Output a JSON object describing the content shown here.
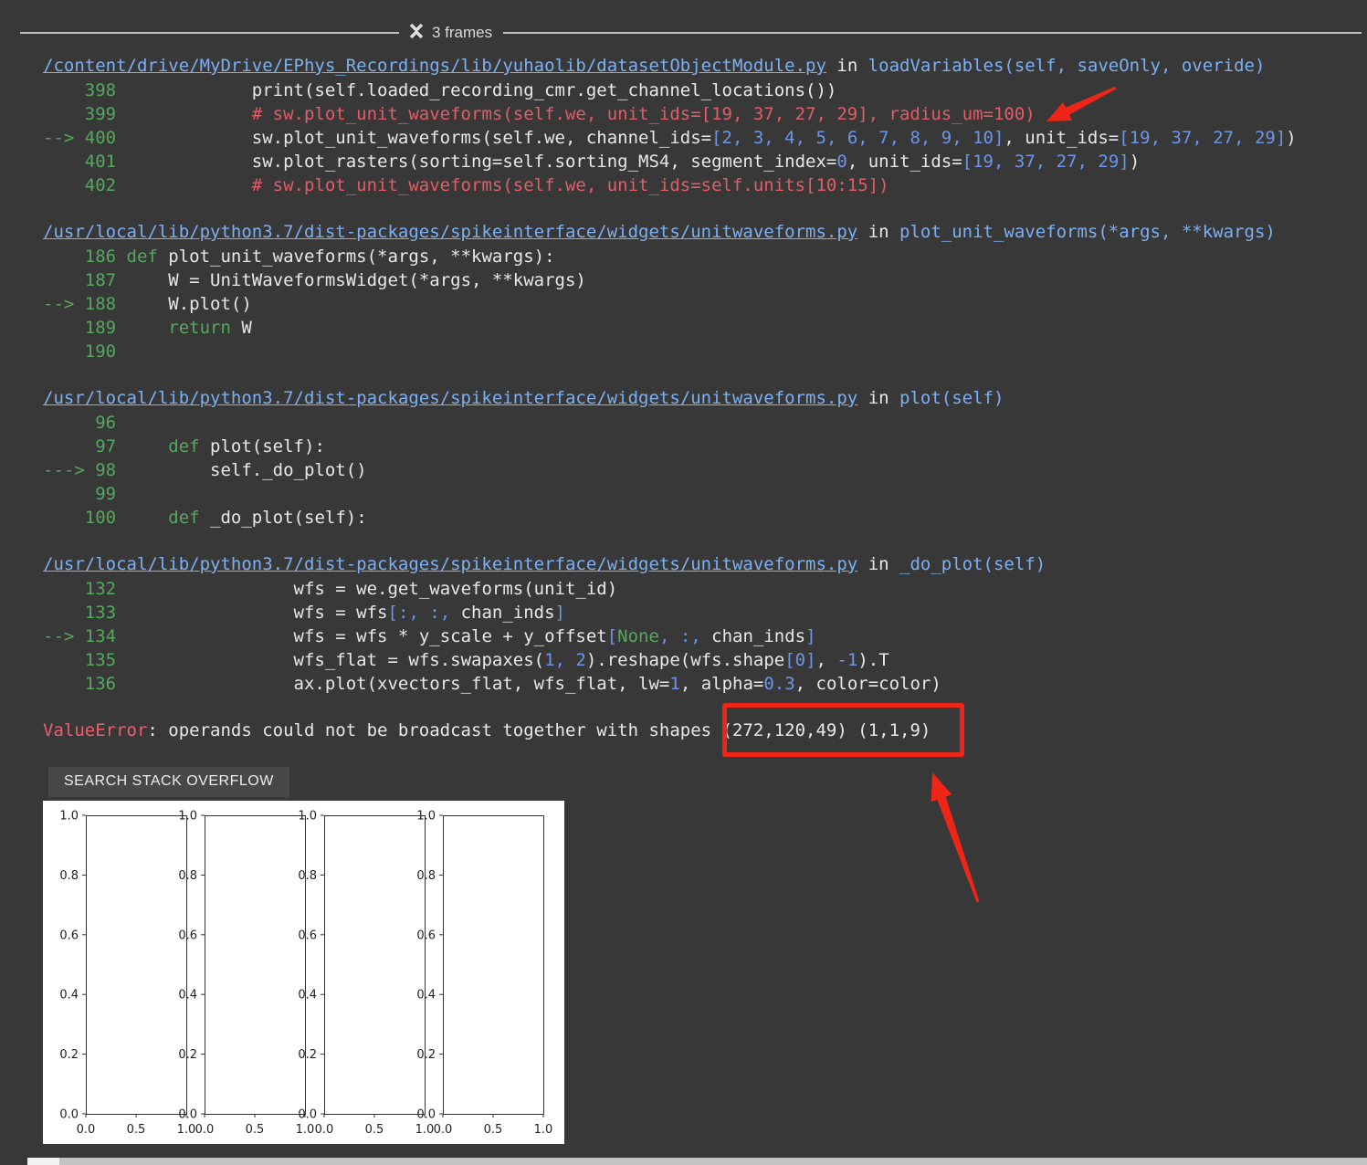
{
  "frames_header": {
    "label": "3 frames",
    "icon": "collapse-icon"
  },
  "colors": {
    "background": "#383838",
    "link_blue": "#7db0f2",
    "code_white": "#e8e8e8",
    "green": "#55a85e",
    "comment_red": "#e25d66",
    "number_blue": "#6d95e8",
    "error_pink": "#ec5f6d",
    "annotation_red": "#ee2517",
    "divider_gray": "#c0c0c0",
    "button_bg": "#484848",
    "figure_bg": "#ffffff"
  },
  "traceback": {
    "frames": [
      {
        "path": "/content/drive/MyDrive/EPhys_Recordings/lib/yuhaolib/datasetObjectModule.py",
        "context": "loadVariables(self, saveOnly, overide)",
        "lines": [
          {
            "gutter": "    398",
            "indent": 12,
            "segments": [
              [
                "w",
                "print(self.loaded_recording_cmr.get_channel_locations())"
              ]
            ]
          },
          {
            "gutter": "    399",
            "indent": 12,
            "segments": [
              [
                "c",
                "# sw.plot_unit_waveforms(self.we, unit_ids=[19, 37, 27, 29], radius_um=100)"
              ]
            ]
          },
          {
            "gutter": "--> 400",
            "indent": 12,
            "segments": [
              [
                "w",
                "sw.plot_unit_waveforms(self.we, channel_ids="
              ],
              [
                "n",
                "[2, 3, 4, 5, 6, 7, 8, 9, 10]"
              ],
              [
                "w",
                ", unit_ids="
              ],
              [
                "n",
                "[19, 37, 27, 29]"
              ],
              [
                "w",
                ")"
              ]
            ]
          },
          {
            "gutter": "    401",
            "indent": 12,
            "segments": [
              [
                "w",
                "sw.plot_rasters(sorting=self.sorting_MS4, segment_index="
              ],
              [
                "n",
                "0"
              ],
              [
                "w",
                ", unit_ids="
              ],
              [
                "n",
                "[19, 37, 27, 29]"
              ],
              [
                "w",
                ")"
              ]
            ]
          },
          {
            "gutter": "    402",
            "indent": 12,
            "segments": [
              [
                "c",
                "# sw.plot_unit_waveforms(self.we, unit_ids=self.units[10:15])"
              ]
            ]
          }
        ]
      },
      {
        "path": "/usr/local/lib/python3.7/dist-packages/spikeinterface/widgets/unitwaveforms.py",
        "context": "plot_unit_waveforms(*args, **kwargs)",
        "lines": [
          {
            "gutter": "    186",
            "indent": 0,
            "segments": [
              [
                "k",
                "def"
              ],
              [
                "w",
                " plot_unit_waveforms(*args, **kwargs):"
              ]
            ]
          },
          {
            "gutter": "    187",
            "indent": 4,
            "segments": [
              [
                "w",
                "W = UnitWaveformsWidget(*args, **kwargs)"
              ]
            ]
          },
          {
            "gutter": "--> 188",
            "indent": 4,
            "segments": [
              [
                "w",
                "W.plot()"
              ]
            ]
          },
          {
            "gutter": "    189",
            "indent": 4,
            "segments": [
              [
                "k",
                "return"
              ],
              [
                "w",
                " W"
              ]
            ]
          },
          {
            "gutter": "    190",
            "indent": 0,
            "segments": []
          }
        ]
      },
      {
        "path": "/usr/local/lib/python3.7/dist-packages/spikeinterface/widgets/unitwaveforms.py",
        "context": "plot(self)",
        "lines": [
          {
            "gutter": "     96",
            "indent": 0,
            "segments": []
          },
          {
            "gutter": "     97",
            "indent": 4,
            "segments": [
              [
                "k",
                "def"
              ],
              [
                "w",
                " plot(self):"
              ]
            ]
          },
          {
            "gutter": "---> 98",
            "indent": 8,
            "segments": [
              [
                "w",
                "self._do_plot()"
              ]
            ]
          },
          {
            "gutter": "     99",
            "indent": 0,
            "segments": []
          },
          {
            "gutter": "    100",
            "indent": 4,
            "segments": [
              [
                "k",
                "def"
              ],
              [
                "w",
                " _do_plot(self):"
              ]
            ]
          }
        ]
      },
      {
        "path": "/usr/local/lib/python3.7/dist-packages/spikeinterface/widgets/unitwaveforms.py",
        "context": "_do_plot(self)",
        "lines": [
          {
            "gutter": "    132",
            "indent": 16,
            "segments": [
              [
                "w",
                "wfs = we.get_waveforms(unit_id)"
              ]
            ]
          },
          {
            "gutter": "    133",
            "indent": 16,
            "segments": [
              [
                "w",
                "wfs = wfs"
              ],
              [
                "n",
                "[:, :,"
              ],
              [
                "w",
                " chan_inds"
              ],
              [
                "n",
                "]"
              ]
            ]
          },
          {
            "gutter": "--> 134",
            "indent": 16,
            "segments": [
              [
                "w",
                "wfs = wfs * y_scale + y_offset"
              ],
              [
                "n",
                "["
              ],
              [
                "k",
                "None"
              ],
              [
                "n",
                ", :,"
              ],
              [
                "w",
                " chan_inds"
              ],
              [
                "n",
                "]"
              ]
            ]
          },
          {
            "gutter": "    135",
            "indent": 16,
            "segments": [
              [
                "w",
                "wfs_flat = wfs.swapaxes("
              ],
              [
                "n",
                "1, 2"
              ],
              [
                "w",
                ").reshape(wfs.shape"
              ],
              [
                "n",
                "[0]"
              ],
              [
                "w",
                ", "
              ],
              [
                "n",
                "-1"
              ],
              [
                "w",
                ").T"
              ]
            ]
          },
          {
            "gutter": "    136",
            "indent": 16,
            "segments": [
              [
                "w",
                "ax.plot(xvectors_flat, wfs_flat, lw="
              ],
              [
                "n",
                "1"
              ],
              [
                "w",
                ", alpha="
              ],
              [
                "n",
                "0.3"
              ],
              [
                "w",
                ", color=color)"
              ]
            ]
          }
        ]
      }
    ],
    "error": {
      "name": "ValueError",
      "message": ": operands could not be broadcast together with shapes ",
      "shapes": "(272,120,49) (1,1,9)"
    }
  },
  "button": {
    "label": "SEARCH STACK OVERFLOW"
  },
  "chart_data": {
    "type": "line",
    "title": "",
    "subplots": 4,
    "x_ticks": [
      "0.0",
      "0.5",
      "1.0"
    ],
    "y_ticks": [
      "1.0",
      "0.8",
      "0.6",
      "0.4",
      "0.2",
      "0.0"
    ],
    "xlim": [
      0.0,
      1.0
    ],
    "ylim": [
      0.0,
      1.0
    ],
    "grid": false,
    "legend": false,
    "series": []
  }
}
